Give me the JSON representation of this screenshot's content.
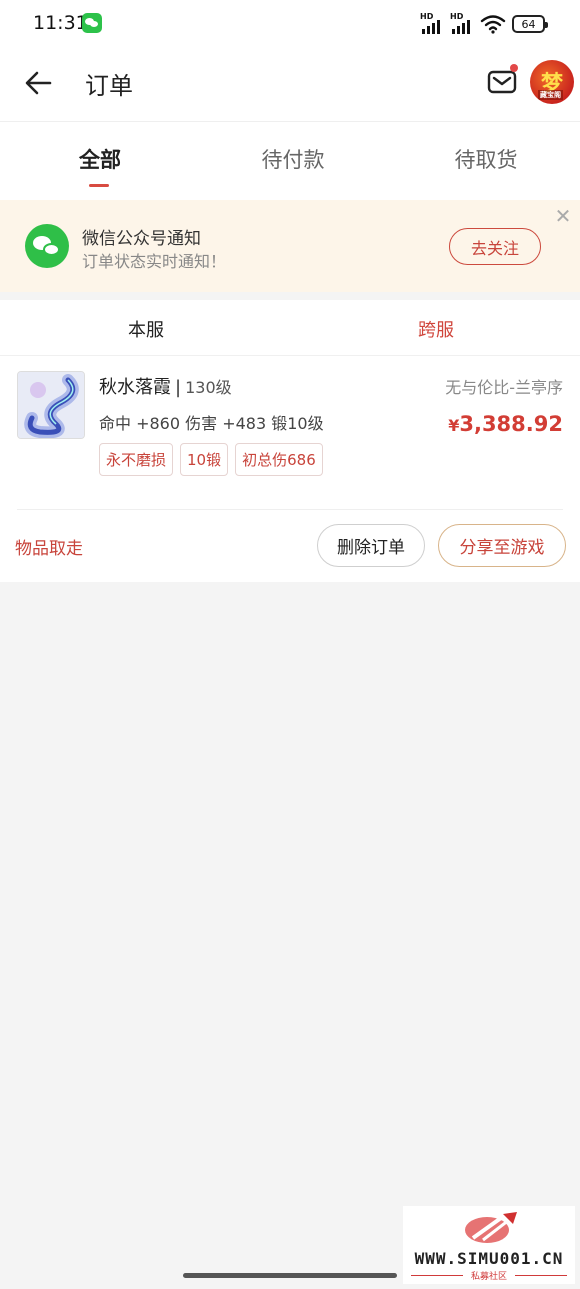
{
  "status_bar": {
    "time": "11:31",
    "battery": "64",
    "signal_labels": [
      "HD",
      "HD"
    ]
  },
  "header": {
    "title": "订单",
    "avatar_glyph": "梦",
    "avatar_caption": "藏宝阁"
  },
  "tabs": [
    {
      "label": "全部",
      "active": true
    },
    {
      "label": "待付款",
      "active": false
    },
    {
      "label": "待取货",
      "active": false
    }
  ],
  "notice": {
    "title": "微信公众号通知",
    "subtitle": "订单状态实时通知！",
    "button": "去关注"
  },
  "server_tabs": [
    {
      "label": "本服",
      "active": false
    },
    {
      "label": "跨服",
      "active": true
    }
  ],
  "order": {
    "item_name": "秋水落霞",
    "separator": "|",
    "level": "130级",
    "server": "无与伦比-兰亭序",
    "attributes": "命中 +860 伤害 +483 锻10级",
    "currency": "¥",
    "price": "3,388.92",
    "tags": [
      "永不磨损",
      "10锻",
      "初总伤686"
    ],
    "status": "物品取走",
    "delete_button": "删除订单",
    "share_button": "分享至游戏"
  },
  "watermark": {
    "site": "WWW.SIMU001.CN",
    "caption": "私募社区"
  },
  "colors": {
    "accent": "#d0463c",
    "price": "#d23d35",
    "banner_bg": "#fdf5e9",
    "wechat_green": "#2fbf48"
  }
}
